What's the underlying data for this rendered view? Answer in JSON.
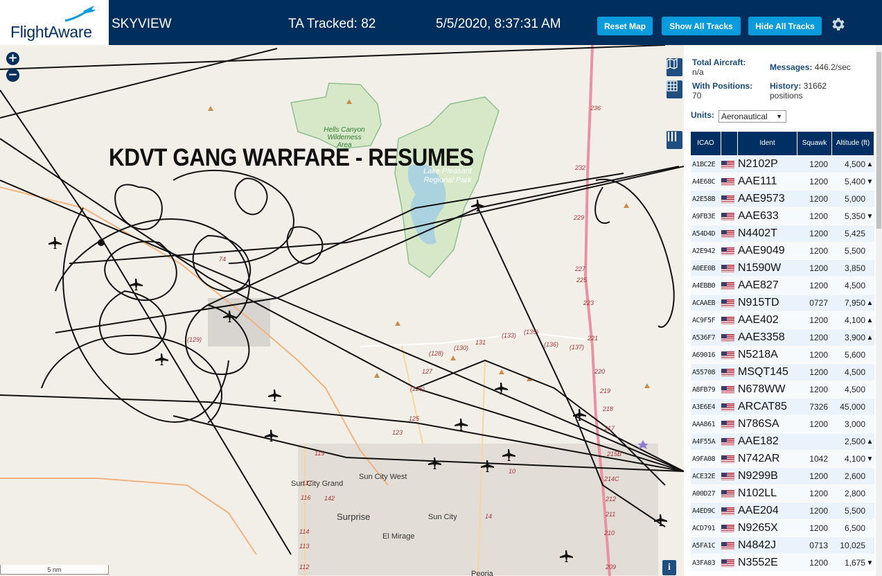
{
  "header": {
    "logo_text": "FlightAware",
    "app_title": "SKYVIEW",
    "ta_tracked": "TA Tracked: 82",
    "clock": "5/5/2020, 8:37:31 AM",
    "buttons": {
      "reset": "Reset Map",
      "show_all": "Show All Tracks",
      "hide_all": "Hide All Tracks"
    },
    "settings_icon": "gear-icon"
  },
  "map": {
    "overlay_title": "KDVT GANG WARFARE - RESUMES",
    "zoom_in": "+",
    "zoom_out": "−",
    "scale": "5 nm",
    "info": "i",
    "labels": {
      "hells_canyon": "Hells Canyon Wilderness Area",
      "lake_pleasant": "Lake Pleasant Regional Park",
      "sun_city_grand": "Sun City Grand",
      "sun_city_west": "Sun City West",
      "surprise": "Surprise",
      "sun_city": "Sun City",
      "el_mirage": "El Mirage",
      "peoria": "Peoria"
    },
    "road_labels": [
      "236",
      "232",
      "229",
      "227",
      "225",
      "223",
      "221",
      "220",
      "219",
      "218",
      "217",
      "215B",
      "214C",
      "212",
      "211",
      "210",
      "209",
      "(128)",
      "127",
      "(126)",
      "125",
      "123",
      "119",
      "117",
      "116",
      "114",
      "113",
      "112",
      "142",
      "131",
      "(133)",
      "(135)",
      "(136)",
      "(137)",
      "(130)",
      "14",
      "10",
      "74",
      "(129)"
    ],
    "side_icons": [
      "map-icon",
      "grid-icon",
      "columns-icon"
    ]
  },
  "sidebar": {
    "stats": {
      "total_aircraft_label": "Total Aircraft:",
      "total_aircraft_value": "n/a",
      "messages_label": "Messages:",
      "messages_value": "446.2/sec",
      "with_positions_label": "With Positions:",
      "with_positions_value": "70",
      "history_label": "History:",
      "history_value": "31662 positions"
    },
    "units_label": "Units:",
    "units_value": "Aeronautical",
    "columns": {
      "icao": "ICAO",
      "ident": "Ident",
      "squawk": "Squawk",
      "altitude": "Altitude (ft)"
    },
    "rows": [
      {
        "icao": "A1BC2E",
        "ident": "N2102P",
        "squawk": "1200",
        "alt": "4,500",
        "trend": "▲"
      },
      {
        "icao": "A4E68C",
        "ident": "AAE111",
        "squawk": "1200",
        "alt": "5,400",
        "trend": "▼"
      },
      {
        "icao": "A2E58B",
        "ident": "AAE9573",
        "squawk": "1200",
        "alt": "5,000",
        "trend": ""
      },
      {
        "icao": "A9FB3E",
        "ident": "AAE633",
        "squawk": "1200",
        "alt": "5,350",
        "trend": "▼"
      },
      {
        "icao": "A54D4D",
        "ident": "N4402T",
        "squawk": "1200",
        "alt": "5,425",
        "trend": ""
      },
      {
        "icao": "A2E942",
        "ident": "AAE9049",
        "squawk": "1200",
        "alt": "5,500",
        "trend": ""
      },
      {
        "icao": "A0EE0B",
        "ident": "N1590W",
        "squawk": "1200",
        "alt": "3,850",
        "trend": ""
      },
      {
        "icao": "A4EBB0",
        "ident": "AAE827",
        "squawk": "1200",
        "alt": "4,500",
        "trend": ""
      },
      {
        "icao": "ACAAEB",
        "ident": "N915TD",
        "squawk": "0727",
        "alt": "7,950",
        "trend": "▲"
      },
      {
        "icao": "AC9F5F",
        "ident": "AAE402",
        "squawk": "1200",
        "alt": "4,100",
        "trend": "▲"
      },
      {
        "icao": "A536F7",
        "ident": "AAE3358",
        "squawk": "1200",
        "alt": "3,900",
        "trend": "▲"
      },
      {
        "icao": "A69016",
        "ident": "N5218A",
        "squawk": "1200",
        "alt": "5,600",
        "trend": ""
      },
      {
        "icao": "A55708",
        "ident": "MSQT145",
        "squawk": "1200",
        "alt": "4,500",
        "trend": ""
      },
      {
        "icao": "A8FB79",
        "ident": "N678WW",
        "squawk": "1200",
        "alt": "4,500",
        "trend": ""
      },
      {
        "icao": "A3E6E4",
        "ident": "ARCAT85",
        "squawk": "7326",
        "alt": "45,000",
        "trend": ""
      },
      {
        "icao": "AAA861",
        "ident": "N786SA",
        "squawk": "1200",
        "alt": "3,000",
        "trend": ""
      },
      {
        "icao": "A4F55A",
        "ident": "AAE182",
        "squawk": "",
        "alt": "2,500",
        "trend": "▲"
      },
      {
        "icao": "A9FA08",
        "ident": "N742AR",
        "squawk": "1042",
        "alt": "4,100",
        "trend": "▼"
      },
      {
        "icao": "ACE32E",
        "ident": "N9299B",
        "squawk": "1200",
        "alt": "2,600",
        "trend": ""
      },
      {
        "icao": "A00D27",
        "ident": "N102LL",
        "squawk": "1200",
        "alt": "2,800",
        "trend": ""
      },
      {
        "icao": "A4ED9C",
        "ident": "AAE204",
        "squawk": "1200",
        "alt": "5,500",
        "trend": ""
      },
      {
        "icao": "ACD791",
        "ident": "N9265X",
        "squawk": "1200",
        "alt": "6,500",
        "trend": ""
      },
      {
        "icao": "A5FA1C",
        "ident": "N4842J",
        "squawk": "0713",
        "alt": "10,025",
        "trend": ""
      },
      {
        "icao": "A3FA03",
        "ident": "N3552E",
        "squawk": "1200",
        "alt": "1,675",
        "trend": "▼"
      }
    ]
  }
}
